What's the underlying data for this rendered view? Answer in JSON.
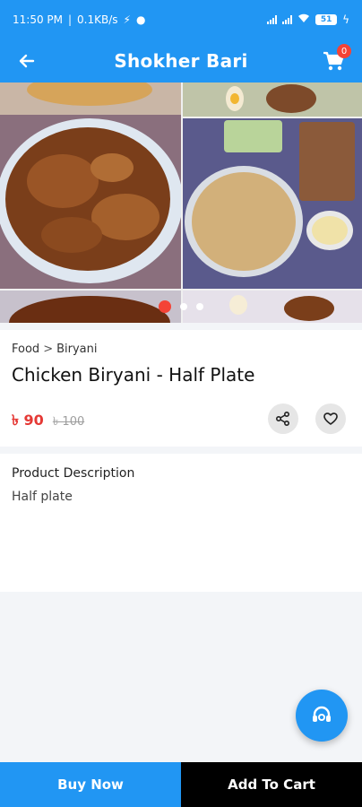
{
  "status_bar": {
    "time": "11:50 PM",
    "network_speed": "0.1KB/s",
    "battery": "51"
  },
  "app_bar": {
    "title": "Shokher Bari",
    "cart_count": "0"
  },
  "gallery": {
    "image_count": 3,
    "active_index": 0
  },
  "product": {
    "breadcrumb_category": "Food",
    "breadcrumb_separator": ">",
    "breadcrumb_subcategory": "Biryani",
    "name": "Chicken Biryani - Half Plate",
    "price": "৳ 90",
    "old_price": "৳ 100"
  },
  "description": {
    "title": "Product Description",
    "text": "Half plate"
  },
  "actions": {
    "buy_now": "Buy Now",
    "add_to_cart": "Add To Cart"
  },
  "colors": {
    "primary": "#2196f3",
    "price_red": "#e53935",
    "add_to_cart_bg": "#000000"
  }
}
